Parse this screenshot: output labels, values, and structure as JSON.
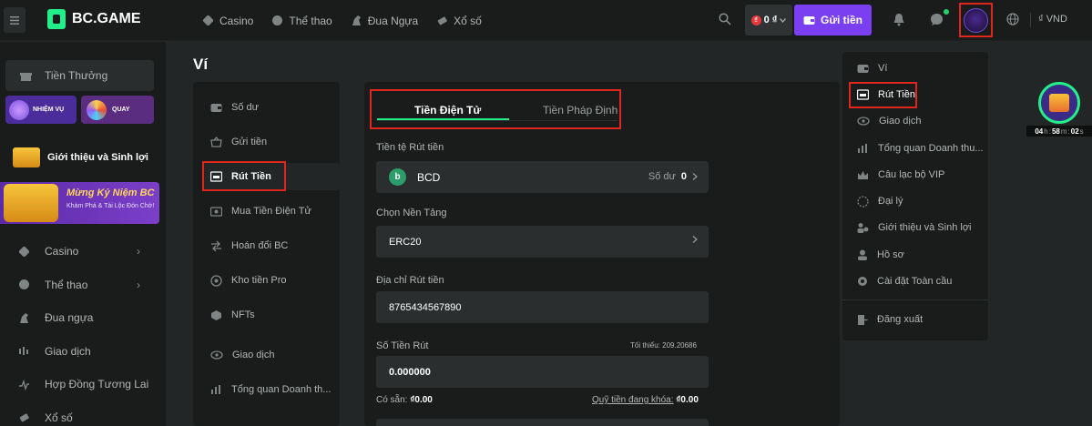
{
  "brand": {
    "name": "BC.GAME",
    "logo_color": "#24ee89"
  },
  "topnav": [
    {
      "label": "Casino",
      "icon": "casino-icon"
    },
    {
      "label": "Thể thao",
      "icon": "sports-icon"
    },
    {
      "label": "Đua Ngựa",
      "icon": "horse-icon"
    },
    {
      "label": "Xổ số",
      "icon": "lottery-icon"
    }
  ],
  "header": {
    "balance": "0 ₫",
    "deposit_label": "Gửi tiền",
    "currency": "₫ VND",
    "accent": "#7b3ff2"
  },
  "sidebar": {
    "bonus": "Tiền Thưởng",
    "promo_quest": "NHIỆM VỤ",
    "promo_spin": "QUAY",
    "referral": "Giới thiệu và Sinh lợi",
    "anniversary_title": "Mừng Kỷ Niệm BC",
    "anniversary_sub": "Khám Phá & Tài Lộc Đón Chờ!",
    "items": [
      {
        "label": "Casino",
        "icon": "casino-icon",
        "chevron": true
      },
      {
        "label": "Thể thao",
        "icon": "sports-icon",
        "chevron": true
      },
      {
        "label": "Đua ngựa",
        "icon": "horse-icon",
        "chevron": false
      },
      {
        "label": "Giao dịch",
        "icon": "trade-icon",
        "chevron": false
      },
      {
        "label": "Hợp Đồng Tương Lai",
        "icon": "futures-icon",
        "chevron": false
      },
      {
        "label": "Xổ số",
        "icon": "lottery-icon",
        "chevron": false
      }
    ]
  },
  "page": {
    "title": "Ví"
  },
  "wallet_nav": [
    {
      "label": "Số dư",
      "icon": "wallet-icon"
    },
    {
      "label": "Gửi tiền",
      "icon": "deposit-icon"
    },
    {
      "label": "Rút Tiền",
      "icon": "withdraw-icon",
      "active": true
    },
    {
      "label": "Mua Tiền Điện Tử",
      "icon": "buy-crypto-icon"
    },
    {
      "label": "Hoán đổi BC",
      "icon": "swap-icon"
    },
    {
      "label": "Kho tiền Pro",
      "icon": "vault-icon"
    },
    {
      "label": "NFTs",
      "icon": "nft-icon"
    },
    {
      "label": "Giao dịch",
      "icon": "transactions-icon"
    },
    {
      "label": "Tổng quan Doanh th...",
      "icon": "overview-icon"
    }
  ],
  "withdraw": {
    "tab_crypto": "Tiền Điện Tử",
    "tab_fiat": "Tiền Pháp Định",
    "currency_label": "Tiền tệ Rút tiền",
    "currency_value": "BCD",
    "balance_label": "Số dư",
    "balance_value": "0",
    "network_label": "Chọn Nền Tảng",
    "network_value": "ERC20",
    "address_label": "Địa chỉ Rút tiền",
    "address_value": "8765434567890",
    "amount_label": "Số Tiền Rút",
    "min_note": "Tối thiểu: 209.20686",
    "amount_value": "0.000000",
    "available_label": "Có sẵn:",
    "available_value": "₫0.00",
    "locked_label": "Quỹ tiền đang khóa:",
    "locked_value": "₫0.00"
  },
  "dropdown": [
    {
      "label": "Ví",
      "icon": "wallet-icon"
    },
    {
      "label": "Rút Tiền",
      "icon": "withdraw-icon",
      "selected": true
    },
    {
      "label": "Giao dịch",
      "icon": "transactions-icon"
    },
    {
      "label": "Tổng quan Doanh thu...",
      "icon": "overview-icon"
    },
    {
      "label": "Câu lạc bộ VIP",
      "icon": "vip-crown-icon"
    },
    {
      "label": "Đại lý",
      "icon": "agent-icon"
    },
    {
      "label": "Giới thiệu và Sinh lợi",
      "icon": "referral-icon"
    },
    {
      "label": "Hồ sơ",
      "icon": "profile-icon"
    },
    {
      "label": "Cài đặt Toàn cầu",
      "icon": "settings-icon"
    },
    {
      "label": "Đăng xuất",
      "icon": "logout-icon"
    }
  ],
  "timer": {
    "h": "04",
    "h_unit": "h",
    "m": "58",
    "m_unit": "m",
    "s": "02",
    "s_unit": "s"
  }
}
